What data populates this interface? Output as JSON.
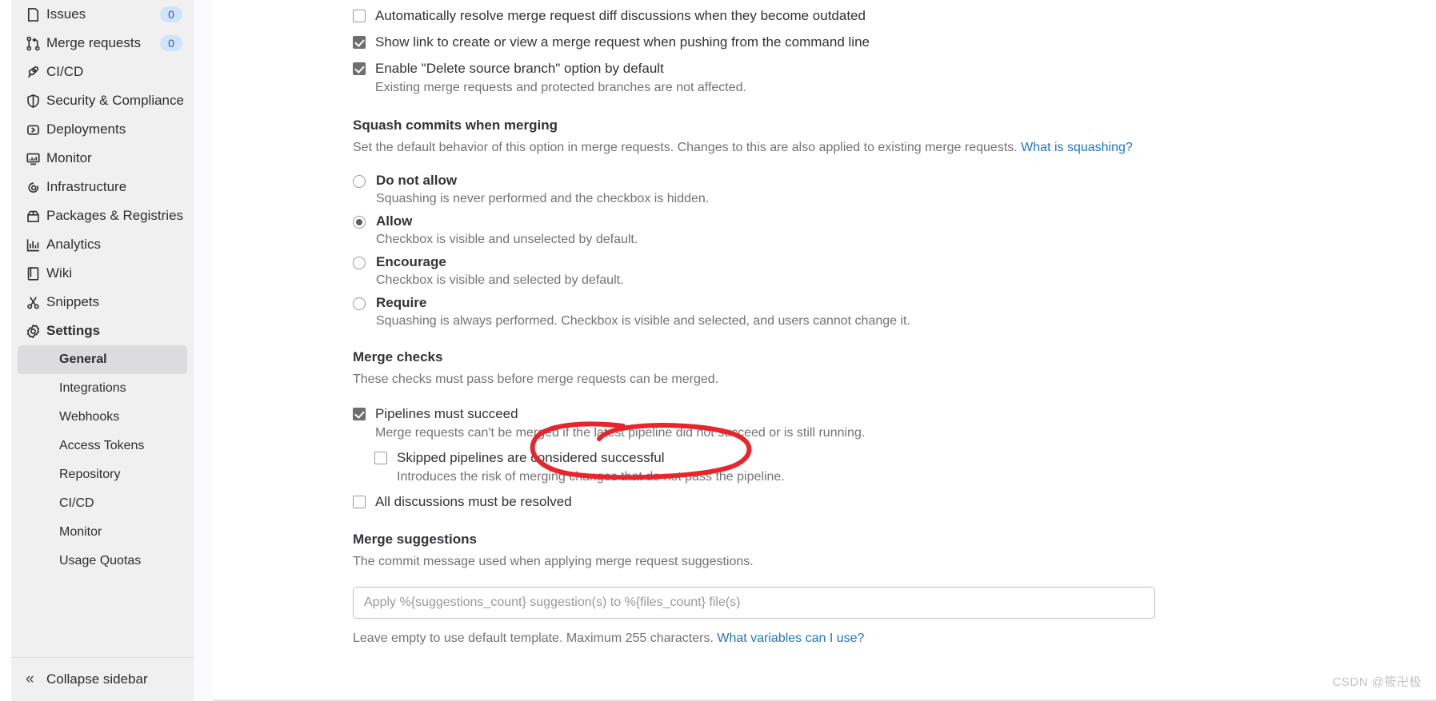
{
  "sidebar": {
    "nav_items": [
      {
        "label": "Issues",
        "icon": "issues-icon",
        "badge": "0"
      },
      {
        "label": "Merge requests",
        "icon": "merge-requests-icon",
        "badge": "0"
      },
      {
        "label": "CI/CD",
        "icon": "rocket-icon",
        "badge": ""
      },
      {
        "label": "Security & Compliance",
        "icon": "shield-icon",
        "badge": ""
      },
      {
        "label": "Deployments",
        "icon": "deployments-icon",
        "badge": ""
      },
      {
        "label": "Monitor",
        "icon": "monitor-icon",
        "badge": ""
      },
      {
        "label": "Infrastructure",
        "icon": "infrastructure-icon",
        "badge": ""
      },
      {
        "label": "Packages & Registries",
        "icon": "package-icon",
        "badge": ""
      },
      {
        "label": "Analytics",
        "icon": "analytics-icon",
        "badge": ""
      },
      {
        "label": "Wiki",
        "icon": "book-icon",
        "badge": ""
      },
      {
        "label": "Snippets",
        "icon": "scissors-icon",
        "badge": ""
      },
      {
        "label": "Settings",
        "icon": "gear-icon",
        "badge": ""
      }
    ],
    "settings_subitems": [
      {
        "label": "General",
        "active": true
      },
      {
        "label": "Integrations",
        "active": false
      },
      {
        "label": "Webhooks",
        "active": false
      },
      {
        "label": "Access Tokens",
        "active": false
      },
      {
        "label": "Repository",
        "active": false
      },
      {
        "label": "CI/CD",
        "active": false
      },
      {
        "label": "Monitor",
        "active": false
      },
      {
        "label": "Usage Quotas",
        "active": false
      }
    ],
    "collapse_label": "Collapse sidebar"
  },
  "main": {
    "top_checkboxes": [
      {
        "label": "Automatically resolve merge request diff discussions when they become outdated",
        "checked": false,
        "desc": ""
      },
      {
        "label": "Show link to create or view a merge request when pushing from the command line",
        "checked": true,
        "desc": ""
      },
      {
        "label": "Enable \"Delete source branch\" option by default",
        "checked": true,
        "desc": "Existing merge requests and protected branches are not affected."
      }
    ],
    "squash": {
      "title": "Squash commits when merging",
      "description": "Set the default behavior of this option in merge requests. Changes to this are also applied to existing merge requests.",
      "link_label": "What is squashing?",
      "options": [
        {
          "label": "Do not allow",
          "desc": "Squashing is never performed and the checkbox is hidden.",
          "selected": false
        },
        {
          "label": "Allow",
          "desc": "Checkbox is visible and unselected by default.",
          "selected": true
        },
        {
          "label": "Encourage",
          "desc": "Checkbox is visible and selected by default.",
          "selected": false
        },
        {
          "label": "Require",
          "desc": "Squashing is always performed. Checkbox is visible and selected, and users cannot change it.",
          "selected": false
        }
      ]
    },
    "merge_checks": {
      "title": "Merge checks",
      "description": "These checks must pass before merge requests can be merged.",
      "pipelines": {
        "label": "Pipelines must succeed",
        "checked": true,
        "desc": "Merge requests can't be merged if the latest pipeline did not succeed or is still running."
      },
      "skipped": {
        "label": "Skipped pipelines are considered successful",
        "checked": false,
        "desc": "Introduces the risk of merging changes that do not pass the pipeline."
      },
      "discussions": {
        "label": "All discussions must be resolved",
        "checked": false,
        "desc": ""
      }
    },
    "merge_suggestions": {
      "title": "Merge suggestions",
      "description": "The commit message used when applying merge request suggestions.",
      "input_value": "",
      "input_placeholder": "Apply %{suggestions_count} suggestion(s) to %{files_count} file(s)",
      "help_text": "Leave empty to use default template. Maximum 255 characters.",
      "help_link_label": "What variables can I use?"
    }
  },
  "annotation": {
    "shape": "red-ellipse-highlight",
    "color": "#e8252a",
    "target": "Pipelines must succeed"
  },
  "watermark": {
    "text": "CSDN @筱卍极"
  },
  "colors": {
    "link": "#1f75cb",
    "checkbox_checked": "#6e6e6e",
    "sidebar_bg": "#f0f0f0",
    "active_item_bg": "#dcdcde",
    "annotation_red": "#e8252a"
  }
}
